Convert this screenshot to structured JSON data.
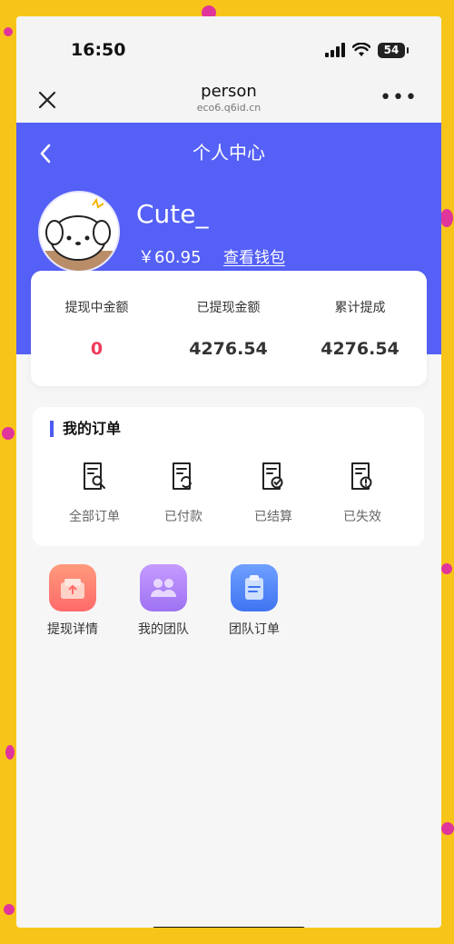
{
  "status_bar": {
    "time": "16:50",
    "battery": "54"
  },
  "browser": {
    "title": "person",
    "url": "eco6.q6id.cn"
  },
  "header": {
    "title": "个人中心"
  },
  "profile": {
    "username": "Cute_",
    "balance": "￥60.95",
    "wallet_link": "查看钱包"
  },
  "stats": [
    {
      "label": "提现中金额",
      "value": "0"
    },
    {
      "label": "已提现金额",
      "value": "4276.54"
    },
    {
      "label": "累计提成",
      "value": "4276.54"
    }
  ],
  "orders": {
    "title": "我的订单",
    "items": [
      {
        "label": "全部订单",
        "icon": "document-search-icon"
      },
      {
        "label": "已付款",
        "icon": "document-refresh-icon"
      },
      {
        "label": "已结算",
        "icon": "document-check-icon"
      },
      {
        "label": "已失效",
        "icon": "document-alert-icon"
      }
    ]
  },
  "features": [
    {
      "label": "提现详情",
      "icon": "withdraw-icon",
      "color": "#ff7b6b"
    },
    {
      "label": "我的团队",
      "icon": "team-icon",
      "color": "#a27bf5"
    },
    {
      "label": "团队订单",
      "icon": "clipboard-icon",
      "color": "#4f86f7"
    }
  ],
  "colors": {
    "accent": "#5560f6",
    "zero_value": "#f0395a"
  }
}
